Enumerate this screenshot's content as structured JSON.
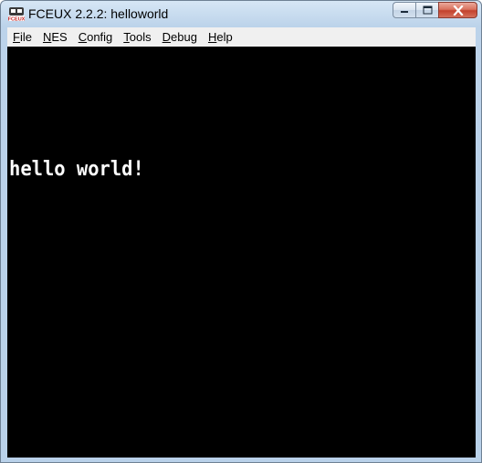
{
  "window": {
    "title": "FCEUX 2.2.2: helloworld",
    "icon": "fceux-app-icon"
  },
  "window_controls": {
    "minimize_icon": "minimize-icon",
    "maximize_icon": "maximize-icon",
    "close_icon": "close-icon"
  },
  "menu": {
    "items": [
      {
        "label": "File"
      },
      {
        "label": "NES"
      },
      {
        "label": "Config"
      },
      {
        "label": "Tools"
      },
      {
        "label": "Debug"
      },
      {
        "label": "Help"
      }
    ]
  },
  "game_screen": {
    "text": "hello world!",
    "background": "#000000",
    "text_color": "#ffffff"
  },
  "colors": {
    "titlebar": "#c6daf0",
    "menubar": "#f0f0f0",
    "close_button": "#c3422d"
  }
}
